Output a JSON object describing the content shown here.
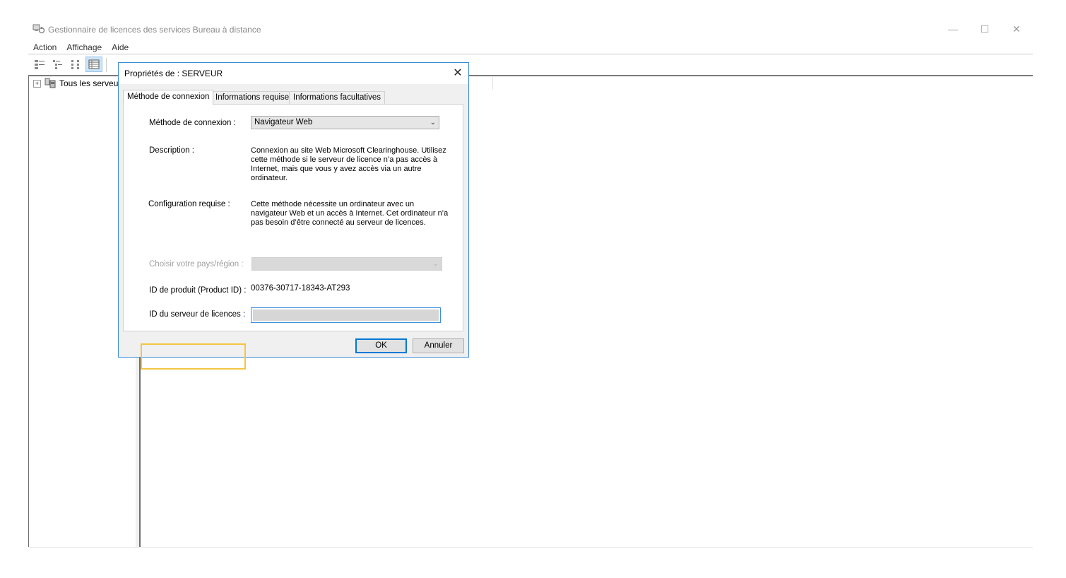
{
  "window": {
    "title": "Gestionnaire de licences des services Bureau à distance",
    "minimize_glyph": "—",
    "maximize_glyph": "☐",
    "close_glyph": "✕"
  },
  "menu": {
    "items": [
      {
        "label": "Action"
      },
      {
        "label": "Affichage"
      },
      {
        "label": "Aide"
      }
    ]
  },
  "toolbar": {
    "icons": [
      "large-icons-view-icon",
      "small-icons-view-icon",
      "list-view-icon",
      "details-view-icon"
    ]
  },
  "tree": {
    "expander": "+",
    "root_label": "Tous les serveurs"
  },
  "dialog": {
    "title": "Propriétés de : SERVEUR",
    "close_glyph": "✕",
    "tabs": [
      {
        "label": "Méthode de connexion",
        "active": true
      },
      {
        "label": "Informations requises",
        "active": false
      },
      {
        "label": "Informations facultatives",
        "active": false
      }
    ],
    "connection_method": {
      "label": "Méthode de connexion :",
      "value": "Navigateur Web"
    },
    "description": {
      "label": "Description :",
      "text": "Connexion au site Web Microsoft Clearinghouse. Utilisez cette méthode si le serveur de licence n’a pas accès à Internet, mais que vous y avez accès via un autre ordinateur."
    },
    "requirements": {
      "label": "Configuration requise :",
      "text": "Cette méthode nécessite un ordinateur avec un navigateur Web et un accès à Internet. Cet ordinateur n’a pas besoin d’être connecté au serveur de licences."
    },
    "country": {
      "label": "Choisir votre pays/région :",
      "value": ""
    },
    "product_id": {
      "label": "ID de produit (Product ID) :",
      "value": "00376-30717-18343-AT293"
    },
    "license_server_id": {
      "label": "ID du serveur de licences :",
      "value": ""
    },
    "buttons": {
      "ok": "OK",
      "cancel": "Annuler"
    }
  },
  "colors": {
    "dialog_border": "#3c8dd9",
    "highlight": "#f4c542",
    "default_button_border": "#0078d7"
  }
}
